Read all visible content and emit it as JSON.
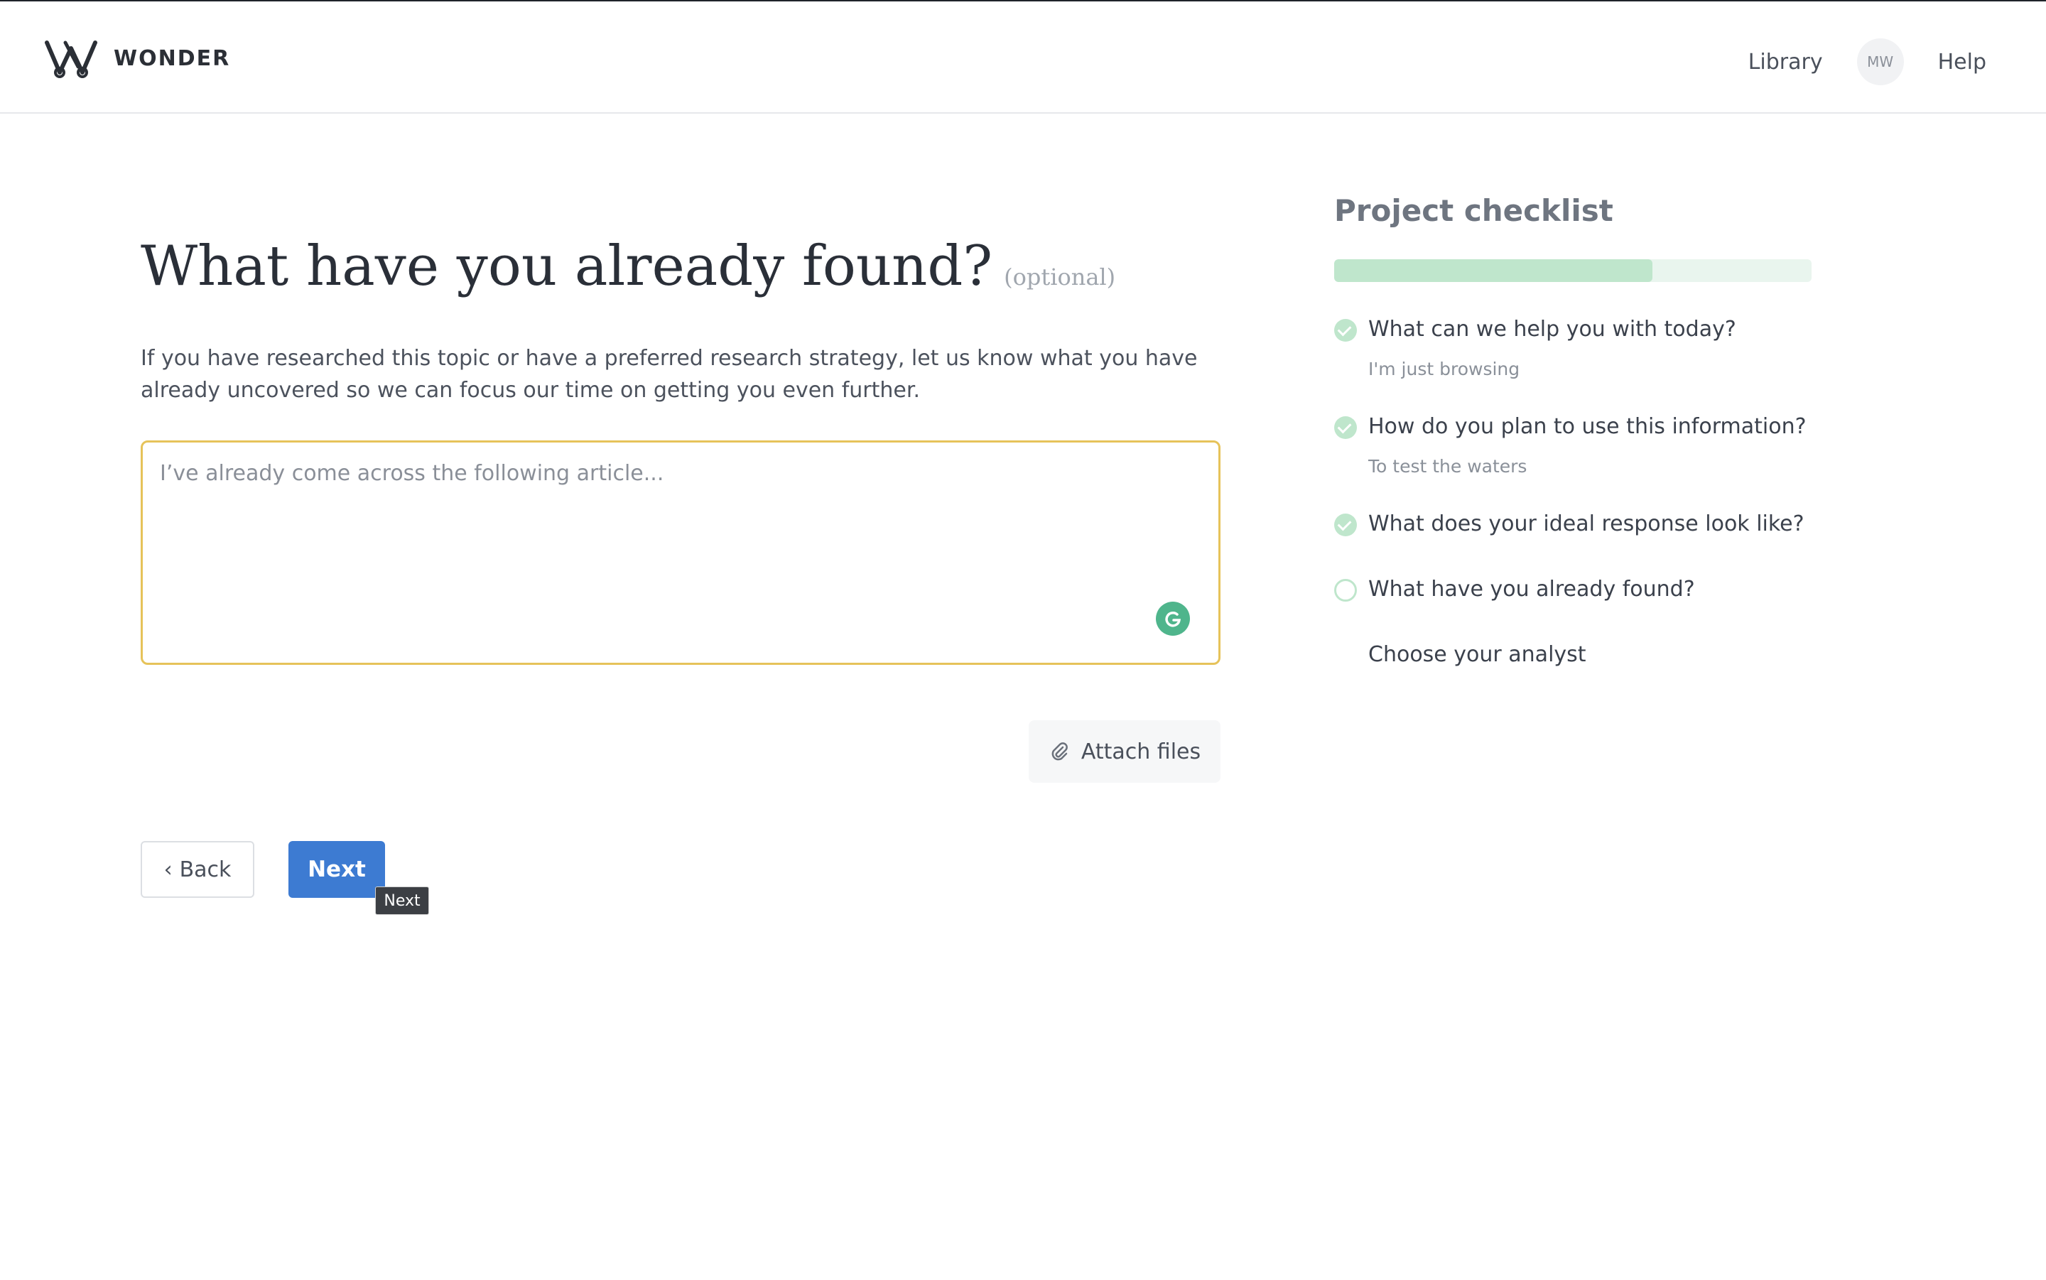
{
  "header": {
    "brand": "WONDER",
    "nav": {
      "library": "Library",
      "avatar": "MW",
      "help": "Help"
    }
  },
  "main": {
    "title": "What have you already found?",
    "optional": "(optional)",
    "description": "If you have researched this topic or have a preferred research strategy, let us know what you have already uncovered so we can focus our time on getting you even further.",
    "textarea_placeholder": "I’ve already come across the following article...",
    "textarea_value": "",
    "attach_label": "Attach files",
    "back_label": "Back",
    "next_label": "Next",
    "tooltip": "Next"
  },
  "checklist": {
    "title": "Project checklist",
    "progress": 0.667,
    "items": [
      {
        "label": "What can we help you with today?",
        "answer": "I'm just browsing",
        "status": "done"
      },
      {
        "label": "How do you plan to use this information?",
        "answer": "To test the waters",
        "status": "done"
      },
      {
        "label": "What does your ideal response look like?",
        "answer": "",
        "status": "done"
      },
      {
        "label": "What have you already found?",
        "answer": "",
        "status": "current"
      },
      {
        "label": "Choose your analyst",
        "answer": "",
        "status": "none"
      }
    ]
  },
  "colors": {
    "accent": "#3d7bd2",
    "check_green": "#bfe6cc",
    "focus_border": "#e6c35a",
    "grammarly": "#4fb58c"
  },
  "icons": {
    "logo": "wonder-logo-icon",
    "attach": "paperclip-icon",
    "back": "chevron-left-icon",
    "grammarly": "grammarly-icon",
    "check": "check-circle-icon",
    "pending": "empty-circle-icon"
  }
}
